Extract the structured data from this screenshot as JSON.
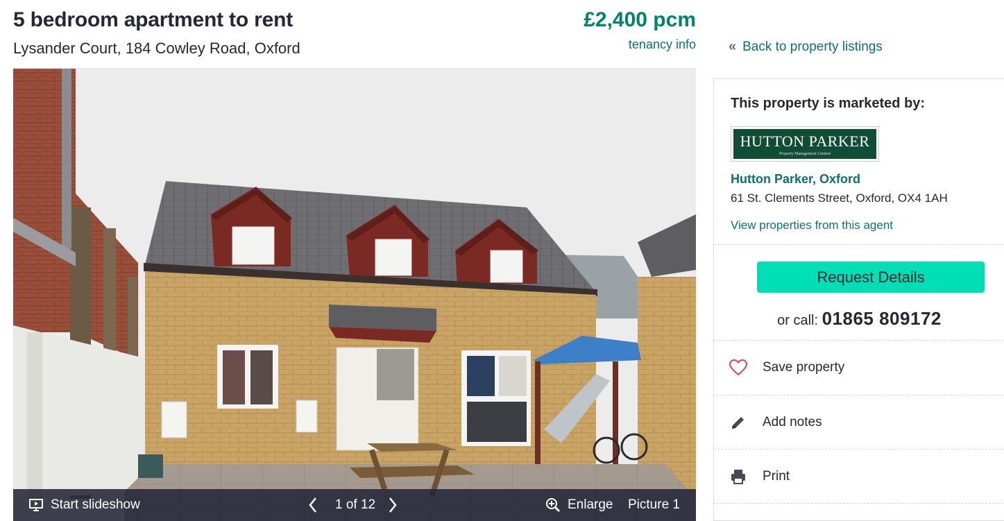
{
  "listing": {
    "title": "5 bedroom apartment to rent",
    "address": "Lysander Court, 184 Cowley Road, Oxford",
    "price": "£2,400 pcm",
    "tenancy_link": "tenancy info"
  },
  "nav": {
    "back_label": "Back to property listings",
    "back_icon": "double-chevron-left-icon"
  },
  "gallery": {
    "slideshow_label": "Start slideshow",
    "counter": "1 of 12",
    "enlarge_label": "Enlarge",
    "picture_label": "Picture 1",
    "icons": [
      "slideshow-icon",
      "chevron-left-icon",
      "chevron-right-icon",
      "zoom-in-icon"
    ]
  },
  "agent": {
    "heading": "This property is marketed by:",
    "logo_text": "HUTTON PARKER",
    "logo_subtext": "Property Management Limited",
    "name": "Hutton Parker, Oxford",
    "address": "61 St. Clements Street, Oxford, OX4 1AH",
    "view_link": "View properties from this agent",
    "request_button": "Request Details",
    "call_prefix": "or call:",
    "phone": "01865 809172"
  },
  "actions": {
    "save": "Save property",
    "notes": "Add notes",
    "print": "Print"
  },
  "colors": {
    "text": "#262637",
    "price": "#00836b",
    "link": "#0e7070",
    "button": "#00deb6",
    "heart": "#e03e52",
    "logo_bg": "#0f4d35"
  }
}
